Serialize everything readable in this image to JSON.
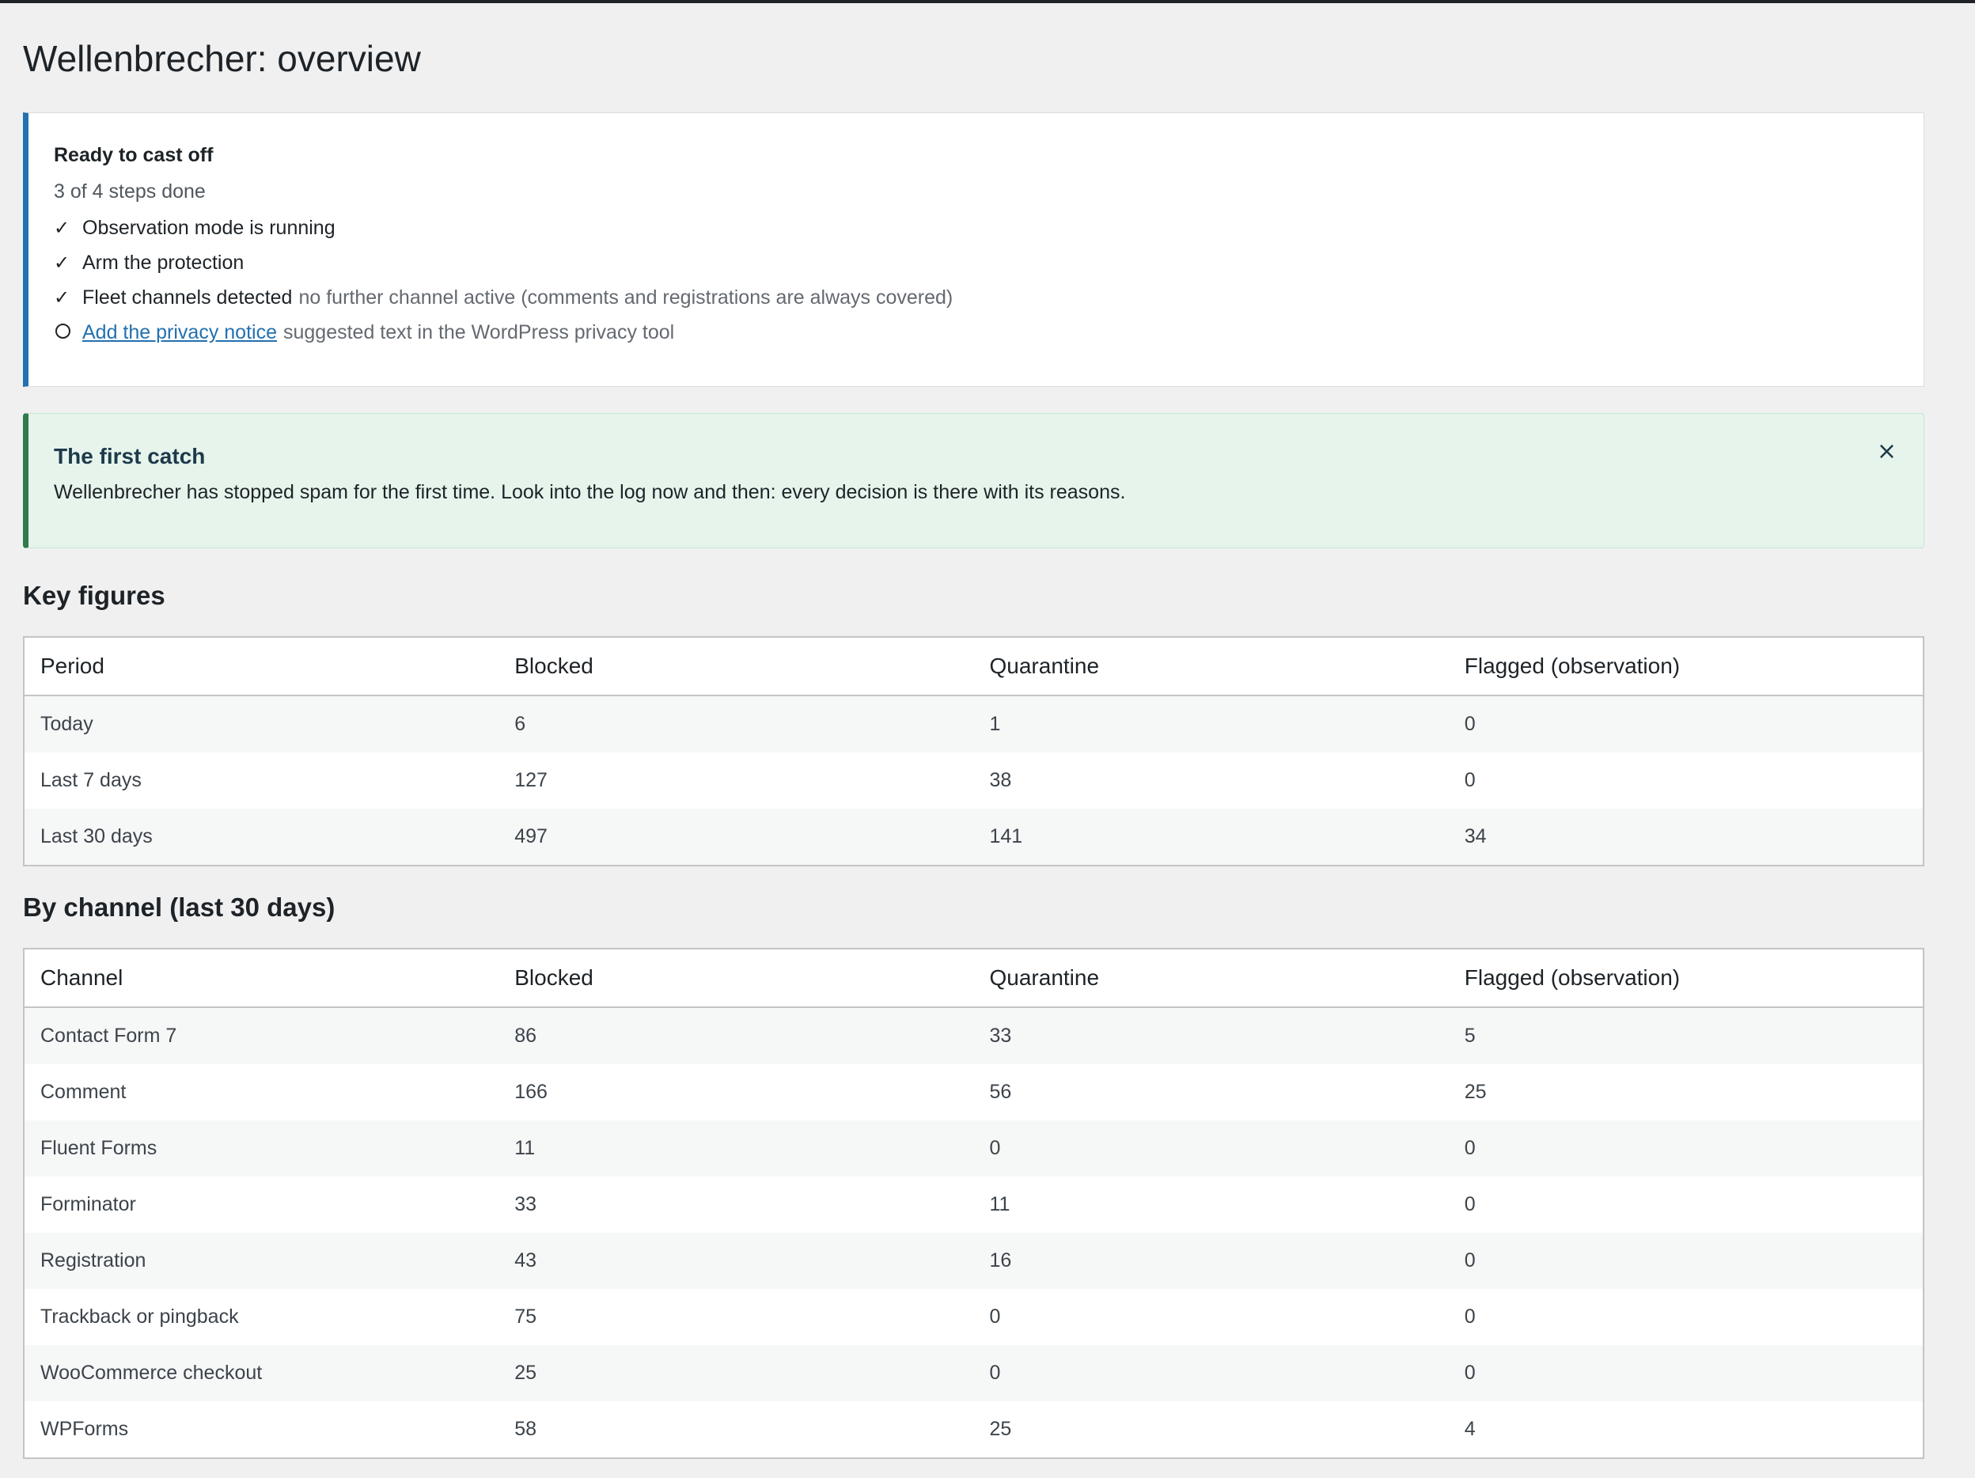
{
  "page": {
    "title": "Wellenbrecher: overview"
  },
  "setup": {
    "title": "Ready to cast off",
    "progress": "3 of 4 steps done",
    "steps": [
      {
        "label": "Observation mode is running",
        "note": ""
      },
      {
        "label": "Arm the protection",
        "note": ""
      },
      {
        "label": "Fleet channels detected",
        "note": "no further channel active (comments and registrations are always covered)"
      },
      {
        "label": "Add the privacy notice",
        "note": "suggested text in the WordPress privacy tool"
      }
    ],
    "check_icon": "✓"
  },
  "notice": {
    "title": "The first catch",
    "body": "Wellenbrecher has stopped spam for the first time. Look into the log now and then: every decision is there with its reasons.",
    "close_icon": "×"
  },
  "key_figures": {
    "heading": "Key figures",
    "columns": [
      "Period",
      "Blocked",
      "Quarantine",
      "Flagged (observation)"
    ],
    "rows": [
      [
        "Today",
        "6",
        "1",
        "0"
      ],
      [
        "Last 7 days",
        "127",
        "38",
        "0"
      ],
      [
        "Last 30 days",
        "497",
        "141",
        "34"
      ]
    ]
  },
  "by_channel": {
    "heading": "By channel (last 30 days)",
    "columns": [
      "Channel",
      "Blocked",
      "Quarantine",
      "Flagged (observation)"
    ],
    "rows": [
      [
        "Contact Form 7",
        "86",
        "33",
        "5"
      ],
      [
        "Comment",
        "166",
        "56",
        "25"
      ],
      [
        "Fluent Forms",
        "11",
        "0",
        "0"
      ],
      [
        "Forminator",
        "33",
        "11",
        "0"
      ],
      [
        "Registration",
        "43",
        "16",
        "0"
      ],
      [
        "Trackback or pingback",
        "75",
        "0",
        "0"
      ],
      [
        "WooCommerce checkout",
        "25",
        "0",
        "0"
      ],
      [
        "WPForms",
        "58",
        "25",
        "4"
      ]
    ]
  }
}
